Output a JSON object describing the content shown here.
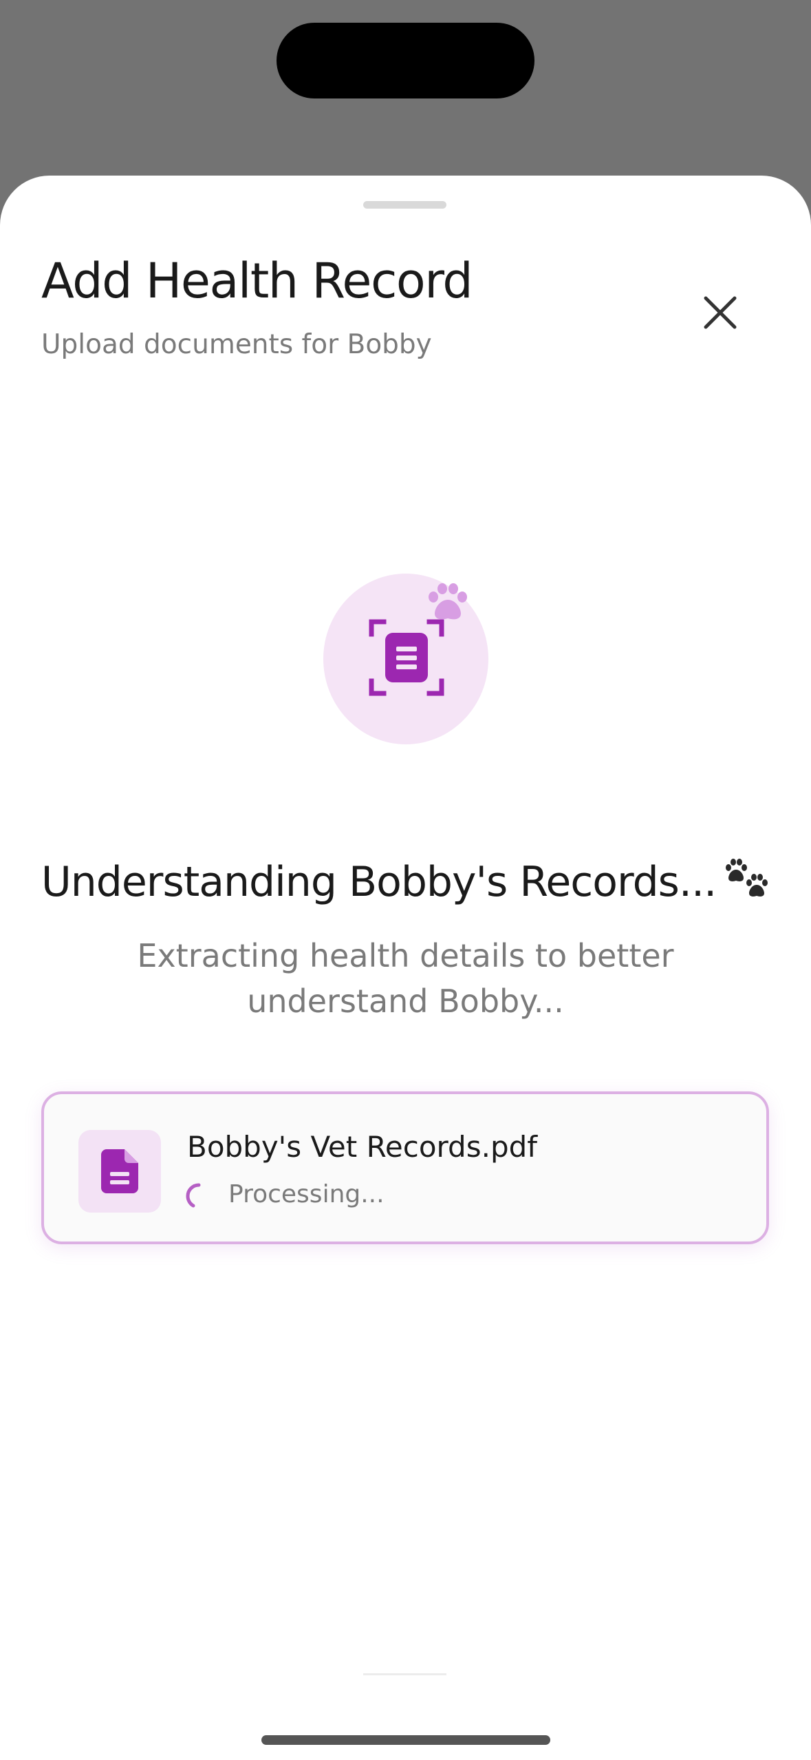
{
  "sheet": {
    "title": "Add Health Record",
    "subtitle": "Upload documents for Bobby"
  },
  "processing": {
    "heading": "Understanding Bobby's Records...",
    "description": "Extracting health details to better understand Bobby..."
  },
  "file": {
    "name": "Bobby's Vet Records.pdf",
    "status": "Processing..."
  },
  "icons": {
    "close": "close-icon",
    "scan_document": "document-scan-icon",
    "paw": "paw-icon",
    "paw_prints": "paw-prints-icon",
    "file": "file-icon",
    "spinner": "loading-spinner-icon"
  },
  "colors": {
    "accent": "#9c27b0",
    "accent_light": "#f5e4f6",
    "paw": "#d89ee3",
    "card_border": "#dcb0e3"
  }
}
